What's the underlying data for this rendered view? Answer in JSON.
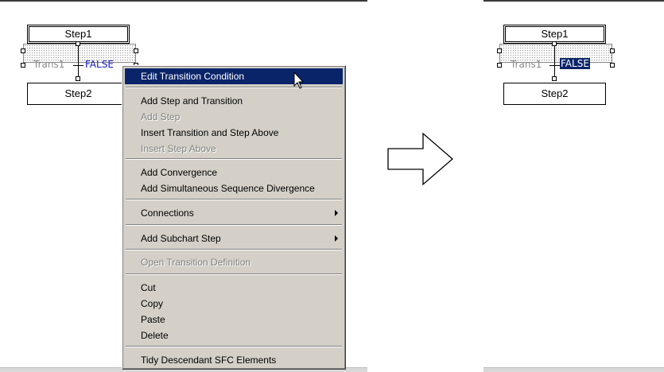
{
  "before": {
    "step1": "Step1",
    "step2": "Step2",
    "trans_name": "Trans1",
    "trans_condition": "FALSE"
  },
  "context_menu": {
    "items": [
      {
        "label": "Edit Transition Condition",
        "state": "highlighted"
      },
      {
        "label": "Add Step and Transition",
        "state": "enabled"
      },
      {
        "label": "Add Step",
        "state": "disabled"
      },
      {
        "label": "Insert Transition and Step Above",
        "state": "enabled"
      },
      {
        "label": "Insert Step Above",
        "state": "disabled"
      },
      {
        "label": "Add Convergence",
        "state": "enabled"
      },
      {
        "label": "Add Simultaneous Sequence Divergence",
        "state": "enabled"
      },
      {
        "label": "Connections",
        "state": "enabled",
        "submenu": true
      },
      {
        "label": "Add Subchart Step",
        "state": "enabled",
        "submenu": true
      },
      {
        "label": "Open Transition Definition",
        "state": "disabled"
      },
      {
        "label": "Cut",
        "state": "enabled"
      },
      {
        "label": "Copy",
        "state": "enabled"
      },
      {
        "label": "Paste",
        "state": "enabled"
      },
      {
        "label": "Delete",
        "state": "enabled"
      },
      {
        "label": "Tidy Descendant SFC Elements",
        "state": "enabled"
      }
    ]
  },
  "after": {
    "step1": "Step1",
    "step2": "Step2",
    "trans_name": "Trans1",
    "trans_condition": "FALSE",
    "trans_condition_selected": true
  },
  "colors": {
    "selection_bg": "#0a246a",
    "condition_text": "#1a1acc",
    "menu_bg": "#d4d0c8"
  },
  "icons": [
    "mouse-pointer-icon",
    "right-arrow-icon",
    "submenu-arrow-icon"
  ]
}
